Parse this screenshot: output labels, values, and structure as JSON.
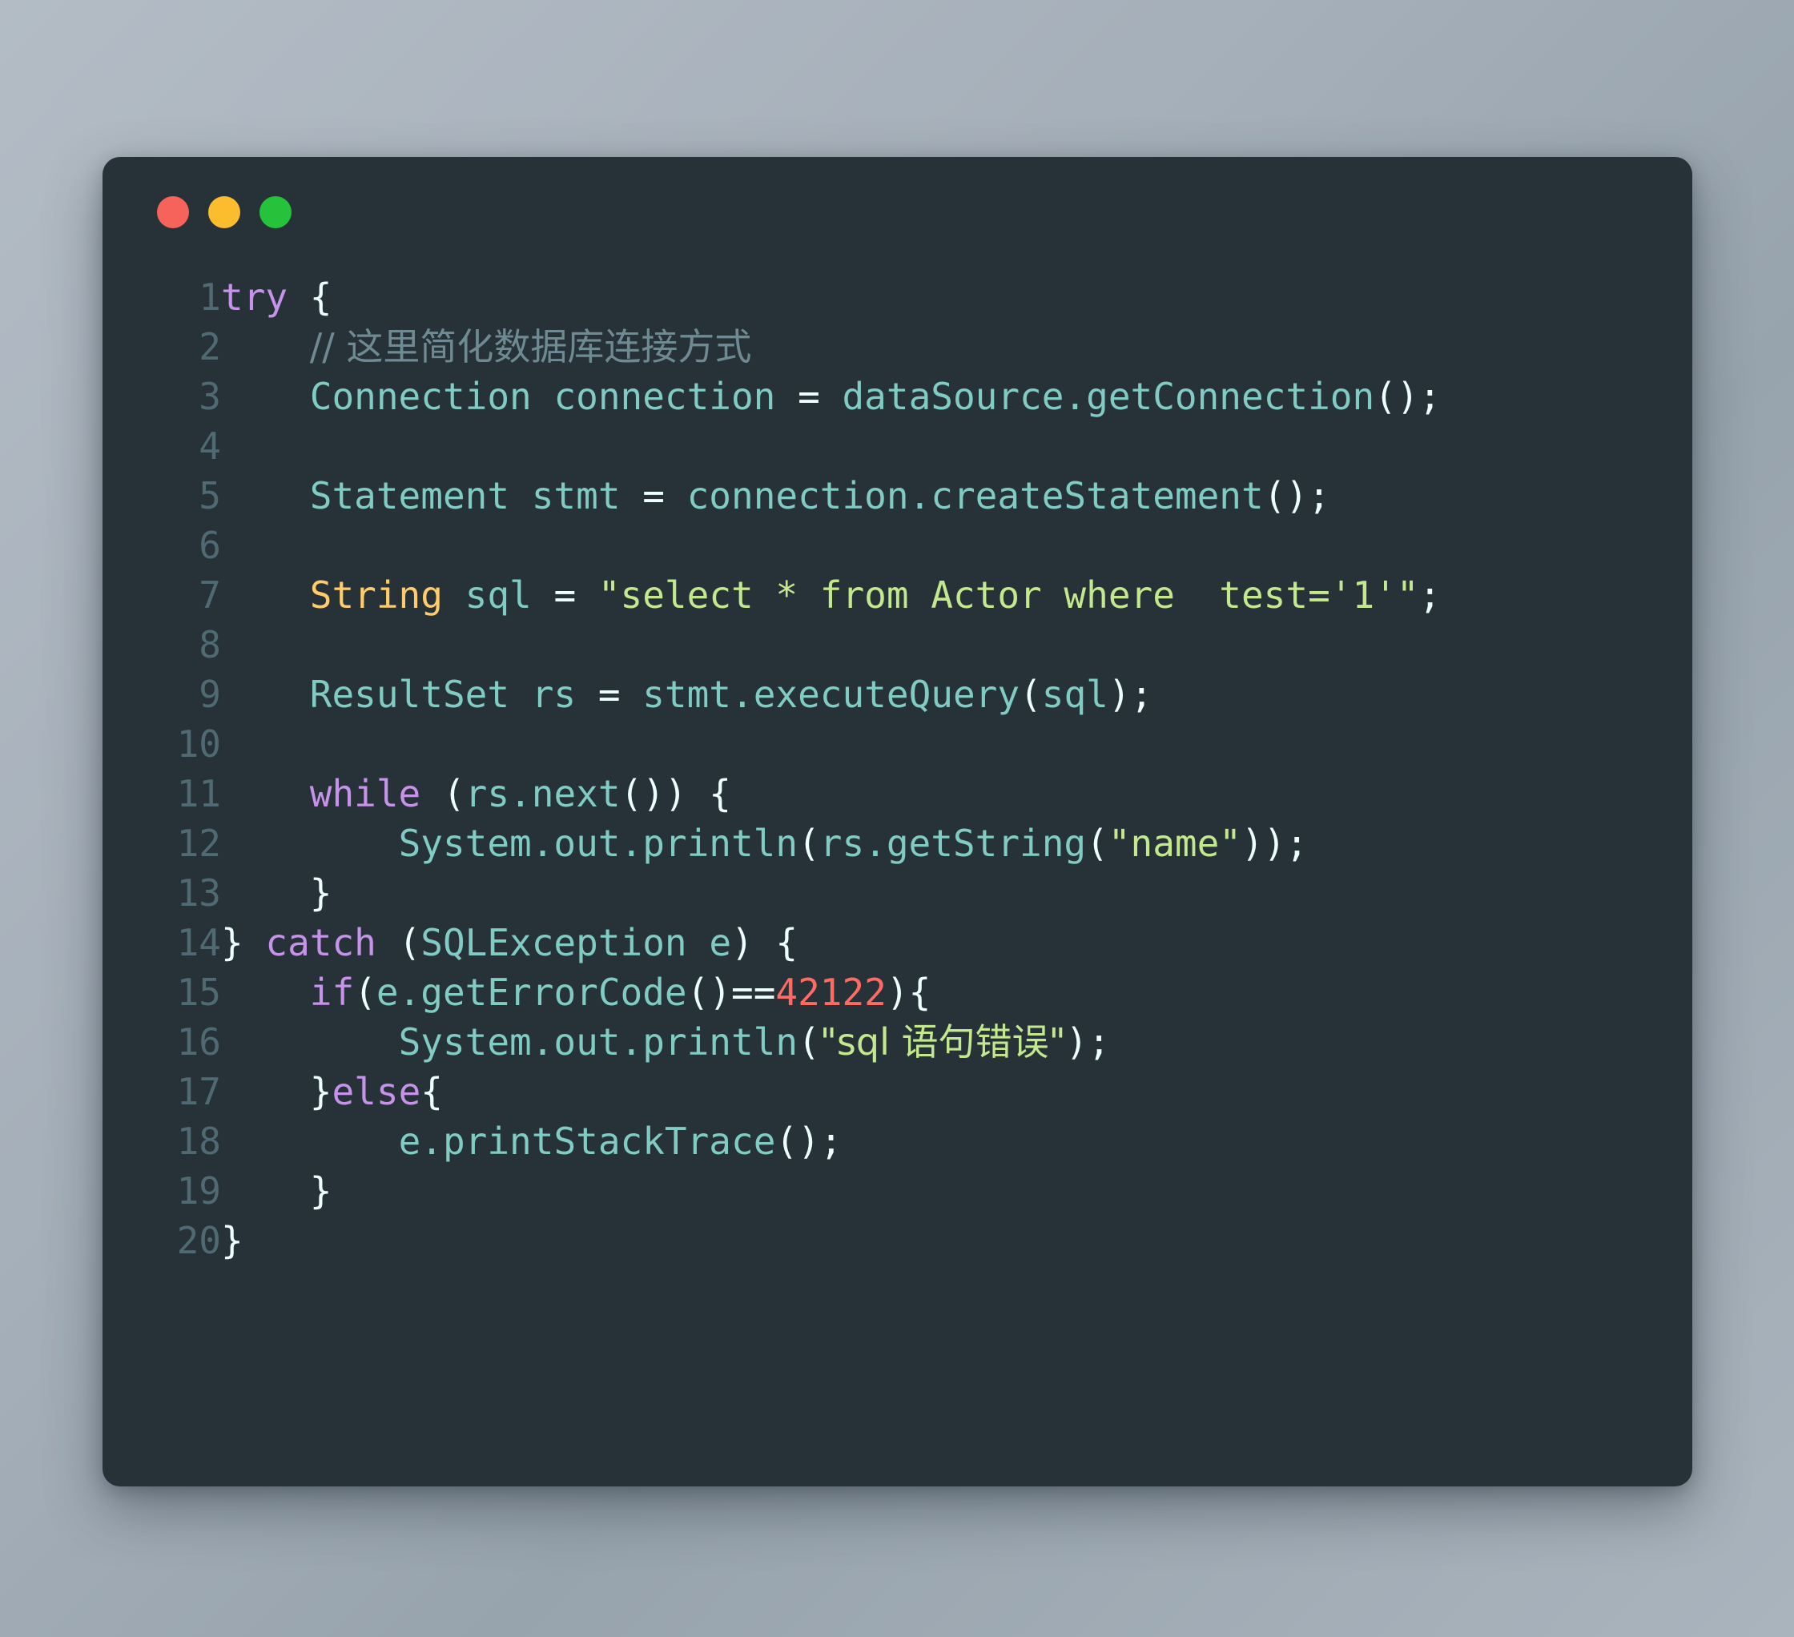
{
  "window": {
    "theme_background": "#263238",
    "page_background": "#a5afb9",
    "traffic_lights": [
      {
        "name": "close",
        "color": "#f5635b"
      },
      {
        "name": "minimize",
        "color": "#fbbd2e"
      },
      {
        "name": "maximize",
        "color": "#27c23c"
      }
    ]
  },
  "editor": {
    "language": "java",
    "line_count": 20,
    "line_numbers": [
      "1",
      "2",
      "3",
      "4",
      "5",
      "6",
      "7",
      "8",
      "9",
      "10",
      "11",
      "12",
      "13",
      "14",
      "15",
      "16",
      "17",
      "18",
      "19",
      "20"
    ],
    "lines": [
      {
        "n": "1",
        "text": "try {"
      },
      {
        "n": "2",
        "text": "    // 这里简化数据库连接方式"
      },
      {
        "n": "3",
        "text": "    Connection connection = dataSource.getConnection();"
      },
      {
        "n": "4",
        "text": ""
      },
      {
        "n": "5",
        "text": "    Statement stmt = connection.createStatement();"
      },
      {
        "n": "6",
        "text": ""
      },
      {
        "n": "7",
        "text": "    String sql = \"select * from Actor where  test='1'\";"
      },
      {
        "n": "8",
        "text": ""
      },
      {
        "n": "9",
        "text": "    ResultSet rs = stmt.executeQuery(sql);"
      },
      {
        "n": "10",
        "text": ""
      },
      {
        "n": "11",
        "text": "    while (rs.next()) {"
      },
      {
        "n": "12",
        "text": "        System.out.println(rs.getString(\"name\"));"
      },
      {
        "n": "13",
        "text": "    }"
      },
      {
        "n": "14",
        "text": "} catch (SQLException e) {"
      },
      {
        "n": "15",
        "text": "    if(e.getErrorCode()==42122){"
      },
      {
        "n": "16",
        "text": "        System.out.println(\"sql 语句错误\");"
      },
      {
        "n": "17",
        "text": "    }else{"
      },
      {
        "n": "18",
        "text": "        e.printStackTrace();"
      },
      {
        "n": "19",
        "text": "    }"
      },
      {
        "n": "20",
        "text": "}"
      }
    ],
    "tokens": {
      "l1": {
        "kw": "try",
        "pun": " {"
      },
      "l2": {
        "comment": "// 这里简化数据库连接方式"
      },
      "l3": {
        "type": "Connection",
        "var": "connection",
        "op": " = ",
        "obj": "dataSource",
        "dot": ".",
        "method": "getConnection",
        "tail": "();"
      },
      "l5": {
        "type": "Statement",
        "var": "stmt",
        "op": " = ",
        "obj": "connection",
        "dot": ".",
        "method": "createStatement",
        "tail": "();"
      },
      "l7": {
        "type": "String",
        "var": "sql",
        "op": " = ",
        "string": "\"select * from Actor where  test='1'\"",
        "tail": ";"
      },
      "l9": {
        "type": "ResultSet",
        "var": "rs",
        "op": " = ",
        "obj": "stmt",
        "dot": ".",
        "method": "executeQuery",
        "arg": "sql",
        "tail": ");"
      },
      "l11": {
        "kw": "while",
        "pun_open": " (",
        "obj": "rs",
        "dot": ".",
        "method": "next",
        "tail": "()) {"
      },
      "l12": {
        "obj": "System.out.println",
        "pun_open": "(",
        "arg": "rs.getString",
        "string": "\"name\"",
        "tail": "));"
      },
      "l13": {
        "pun": "}"
      },
      "l14": {
        "pun_pre": "} ",
        "kw": "catch",
        "pun_open": " (",
        "type": "SQLException",
        "var": "e",
        "tail": ") {"
      },
      "l15": {
        "kw": "if",
        "pun_open": "(",
        "obj": "e",
        "dot": ".",
        "method": "getErrorCode",
        "op": "()==",
        "number": "42122",
        "tail": "){"
      },
      "l16": {
        "obj": "System.out.println",
        "pun_open": "(",
        "string": "\"sql 语句错误\"",
        "tail": ");"
      },
      "l17": {
        "pun_pre": "}",
        "kw": "else",
        "pun_post": "{"
      },
      "l18": {
        "obj": "e",
        "dot": ".",
        "method": "printStackTrace",
        "tail": "();"
      },
      "l19": {
        "pun": "}"
      },
      "l20": {
        "pun": "}"
      }
    },
    "colors": {
      "keyword": "#c792ea",
      "identifier": "#80cbc4",
      "type_highlight": "#ffcb6b",
      "string": "#c3e88d",
      "number": "#ff6b63",
      "punctuation": "#eeffff",
      "comment": "#6f8a93",
      "line_number": "#4f6a72",
      "background": "#263238"
    }
  }
}
